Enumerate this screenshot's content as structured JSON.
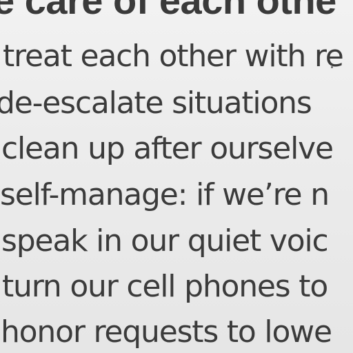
{
  "sign": {
    "heading": "e care of each othe",
    "rules": [
      "treat each other with re",
      "de-escalate situations",
      "clean up after ourselve",
      "self-manage: if we’re n",
      "speak in our quiet voic",
      "turn our cell phones to",
      "honor requests to lowe"
    ]
  },
  "colors": {
    "background": "#ebebeb",
    "text": "#3b3b3b"
  }
}
